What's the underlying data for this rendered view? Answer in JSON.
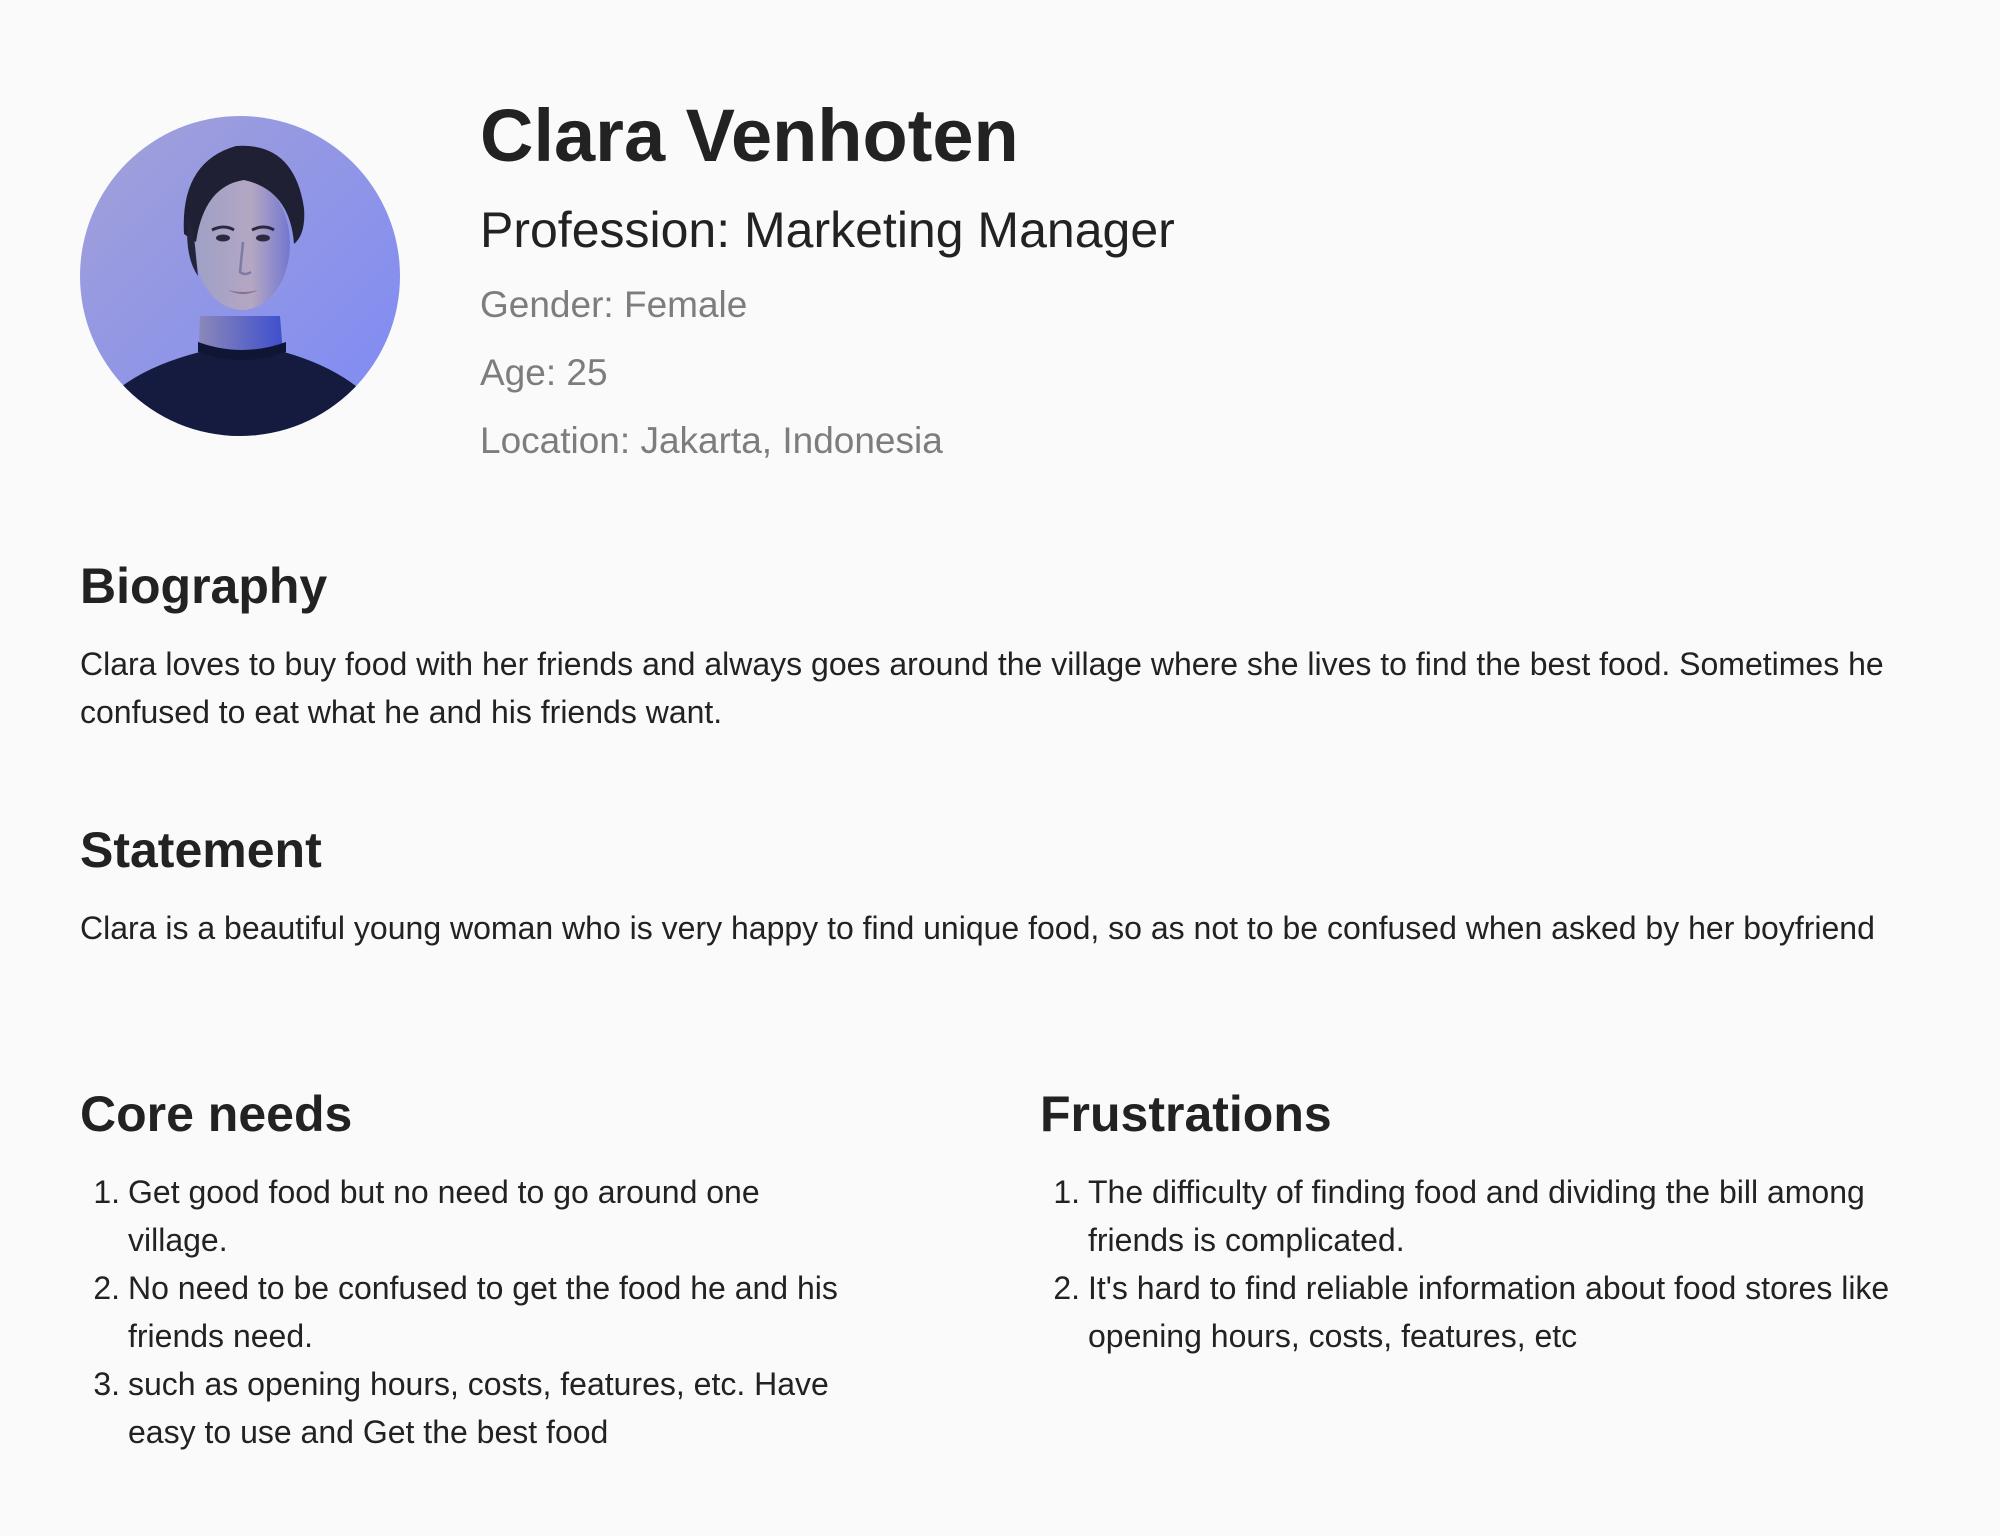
{
  "persona": {
    "name": "Clara Venhoten",
    "profession": "Profession: Marketing Manager",
    "gender": "Gender: Female",
    "age": "Age: 25",
    "location": "Location: Jakarta, Indonesia"
  },
  "biography": {
    "title": "Biography",
    "text": "Clara loves to buy food with her friends and always goes around the village where she lives to find the best food. Sometimes he confused to eat what he and his friends want."
  },
  "statement": {
    "title": "Statement",
    "text": "Clara is a beautiful young woman who is very happy to find unique food, so as not to be confused when asked by her boyfriend"
  },
  "core_needs": {
    "title": "Core needs",
    "items": [
      {
        "num": "1.",
        "text": "Get good food but no need to go around one village."
      },
      {
        "num": "2.",
        "text": "No need to be confused to get the food he and his friends need."
      },
      {
        "num": "3.",
        "text": "such as opening hours, costs, features, etc. Have easy to use and Get the best food"
      }
    ]
  },
  "frustrations": {
    "title": "Frustrations",
    "items": [
      {
        "num": "1.",
        "text": "The difficulty of finding food and dividing the bill among friends is complicated."
      },
      {
        "num": "2.",
        "text": "It's hard to find reliable information about food stores like opening hours, costs, features, etc"
      }
    ]
  },
  "colors": {
    "background": "#fafafa",
    "heading": "#222222",
    "muted": "#7d7d7d",
    "avatar_bg": "#8f96ef"
  }
}
